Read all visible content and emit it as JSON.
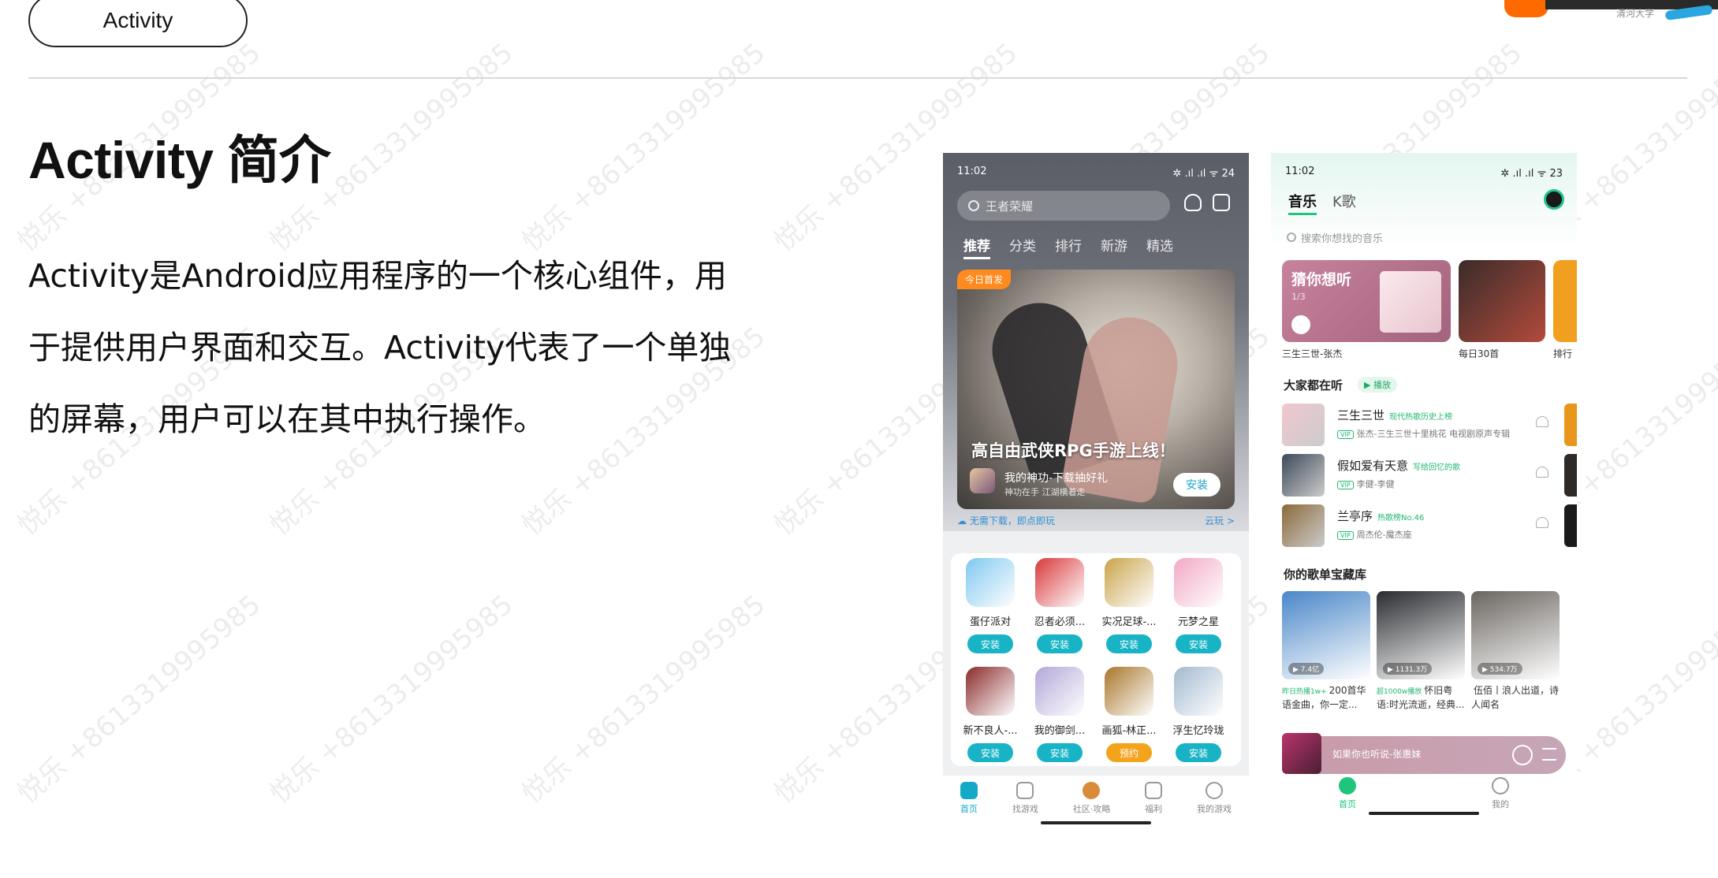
{
  "slide": {
    "tag": "Activity",
    "title": "Activity 简介",
    "body_lines": [
      "Activity是Android应用程序的一个核心组件，用",
      "于提供用户界面和交互。Activity代表了一个单独",
      "的屏幕，用户可以在其中执行操作。"
    ],
    "watermark": "悦乐 +8613319995985",
    "corner_text": "清河大学"
  },
  "phone1": {
    "status_time": "11:02",
    "status_right": "✲ .ıl .ıl ᯤ 24",
    "search_placeholder": "王者荣耀",
    "tabs": [
      "推荐",
      "分类",
      "排行",
      "新游",
      "精选"
    ],
    "banner": {
      "tag": "今日首发",
      "headline": "高自由武侠RPG手游上线！",
      "game_name": "我的神功-下载抽好礼",
      "game_sub": "神功在手 江湖横着走",
      "button": "安装"
    },
    "cloud_text": "无需下载，即点即玩",
    "cloud_link": "云玩 >",
    "games": [
      {
        "name": "蛋仔派对",
        "action": "安装",
        "color": "#7fc8f0"
      },
      {
        "name": "忍者必须...",
        "action": "安装",
        "color": "#d8383a"
      },
      {
        "name": "实况足球-...",
        "action": "安装",
        "color": "#c9a34a"
      },
      {
        "name": "元梦之星",
        "action": "安装",
        "color": "#f2a7c4"
      },
      {
        "name": "新不良人-...",
        "action": "安装",
        "color": "#8a2b2b"
      },
      {
        "name": "我的御剑...",
        "action": "安装",
        "color": "#b3a7d8"
      },
      {
        "name": "画狐-林正...",
        "action": "预约",
        "color": "#a8762a"
      },
      {
        "name": "浮生忆玲珑",
        "action": "安装",
        "color": "#a3b9cf"
      }
    ],
    "nav": [
      "首页",
      "找游戏",
      "社区·攻略",
      "福利",
      "我的游戏"
    ]
  },
  "phone2": {
    "status_time": "11:02",
    "status_right": "✲ .ıl .ıl ᯤ 23",
    "tabs": [
      "音乐",
      "K歌"
    ],
    "search_placeholder": "搜索你想找的音乐",
    "card_main_title": "猜你想听",
    "card_main_counter": "1/3",
    "card_captions": [
      "三生三世-张杰",
      "每日30首",
      "排行"
    ],
    "section_listening": "大家都在听",
    "play_pill": "▶ 播放",
    "songs": [
      {
        "title": "三生三世",
        "highlight": "现代热歌历史上榜",
        "artist": "张杰-三生三世十里桃花 电视剧原声专辑",
        "color": "#f0c7cf"
      },
      {
        "title": "假如爱有天意",
        "highlight": "写给回忆的歌",
        "artist": "李健-李健",
        "color": "#3c4a5a"
      },
      {
        "title": "兰亭序",
        "highlight": "热歌榜No.46",
        "artist": "周杰伦-魔杰座",
        "color": "#8b6a3a"
      }
    ],
    "section_playlist": "你的歌单宝藏库",
    "playlists": [
      {
        "count": "▶ 7.4亿",
        "highlight": "昨日热播1w+",
        "desc": "200首华语金曲，你一定...",
        "color": "#4a87c9"
      },
      {
        "count": "▶ 1131.3万",
        "highlight": "超1000w播放",
        "desc": "怀旧粤语:时光流逝，经典...",
        "color": "#2a2c30"
      },
      {
        "count": "▶ 534.7万",
        "highlight": "",
        "desc": "伍佰丨浪人出道，诗人闻名",
        "color": "#6a6560"
      }
    ],
    "mini_player_text": "如果你也听说-张惠妹",
    "nav": [
      "首页",
      "我的"
    ]
  }
}
